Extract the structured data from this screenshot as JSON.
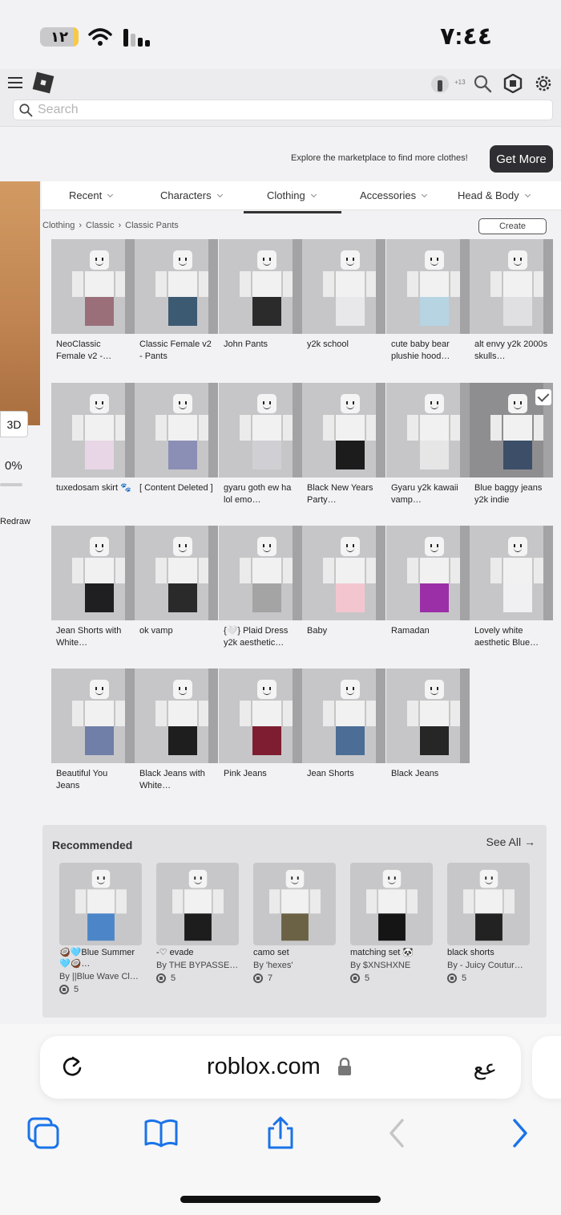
{
  "status": {
    "time": "٧:٤٤",
    "battery": "١٢",
    "battery_level": 0.12
  },
  "header": {
    "icons": [
      "menu-icon",
      "roblox-logo-icon",
      "avatar-icon",
      "search-icon",
      "robux-icon",
      "gear-icon"
    ],
    "age_badge": "+13",
    "search": {
      "placeholder": "Search",
      "value": ""
    }
  },
  "promo": {
    "text": "Explore the marketplace to find more clothes!",
    "button": "Get More"
  },
  "preview": {
    "mode_button": "3D",
    "zoom": "0%",
    "redraw": "Redraw"
  },
  "tabs": [
    {
      "label": "Recent",
      "active": false
    },
    {
      "label": "Characters",
      "active": false
    },
    {
      "label": "Clothing",
      "active": true
    },
    {
      "label": "Accessories",
      "active": false
    },
    {
      "label": "Head & Body",
      "active": false
    }
  ],
  "breadcrumb": [
    "Clothing",
    "Classic",
    "Classic Pants"
  ],
  "create_button": "Create",
  "items": [
    {
      "name": "NeoClassic Female v2 -…",
      "pants": "#9a6f7a"
    },
    {
      "name": "Classic Female v2 - Pants",
      "pants": "#3d5a73"
    },
    {
      "name": "John Pants",
      "pants": "#2b2b2b"
    },
    {
      "name": "y2k school",
      "pants": "#e8e8ea"
    },
    {
      "name": "cute baby bear plushie hood…",
      "pants": "#b7d4e3"
    },
    {
      "name": "alt envy y2k 2000s skulls…",
      "pants": "#e0e0e2"
    },
    {
      "name": "tuxedosam skirt 🐾",
      "pants": "#e8d6e6"
    },
    {
      "name": "[ Content Deleted ]",
      "pants": "#8b8fb5"
    },
    {
      "name": "gyaru goth ew ha lol emo…",
      "pants": "#d0d0d4"
    },
    {
      "name": "Black New Years Party…",
      "pants": "#1c1c1c"
    },
    {
      "name": "Gyaru y2k kawaii vamp…",
      "pants": "#e6e6e6"
    },
    {
      "name": "Blue baggy jeans y2k indie",
      "pants": "#3c4e68",
      "selected": true
    },
    {
      "name": "Jean Shorts with White…",
      "pants": "#1f1f22"
    },
    {
      "name": "ok vamp",
      "pants": "#2a2a2a"
    },
    {
      "name": "{🤍} Plaid Dress y2k aesthetic…",
      "pants": "#a4a4a4"
    },
    {
      "name": "Baby",
      "pants": "#f3c6cf"
    },
    {
      "name": "Ramadan",
      "pants": "#9b2fa8"
    },
    {
      "name": "Lovely white aesthetic Blue…",
      "pants": "#f0f0f2"
    },
    {
      "name": "Beautiful You Jeans",
      "pants": "#6f7fa8"
    },
    {
      "name": "Black Jeans with White…",
      "pants": "#1e1e1e"
    },
    {
      "name": "Pink Jeans",
      "pants": "#7e1d31"
    },
    {
      "name": "Jean Shorts",
      "pants": "#4b6d96"
    },
    {
      "name": "Black Jeans",
      "pants": "#262626"
    }
  ],
  "recommended": {
    "title": "Recommended",
    "see_all": "See All →",
    "cards": [
      {
        "name": "🥥🩵Blue Summer🩵🥥…",
        "by": "By ||Blue Wave Cl…",
        "price": "5",
        "color": "#4d86c8"
      },
      {
        "name": "-♡ evade",
        "by": "By THE BYPASSE…",
        "price": "5",
        "color": "#1d1d1d"
      },
      {
        "name": "camo set",
        "by": "By 'hexes'",
        "price": "7",
        "color": "#6b6246"
      },
      {
        "name": "matching set 🐼",
        "by": "By $XNSHXNE",
        "price": "5",
        "color": "#151515"
      },
      {
        "name": "black shorts",
        "by": "By - Juicy Coutur…",
        "price": "5",
        "color": "#222222"
      }
    ]
  },
  "browser": {
    "url": "roblox.com",
    "text_size": "ﻋﻊ",
    "icons": [
      "reload-icon",
      "lock-icon",
      "tabs-icon",
      "bookmarks-icon",
      "share-icon",
      "back-icon",
      "forward-icon"
    ]
  }
}
